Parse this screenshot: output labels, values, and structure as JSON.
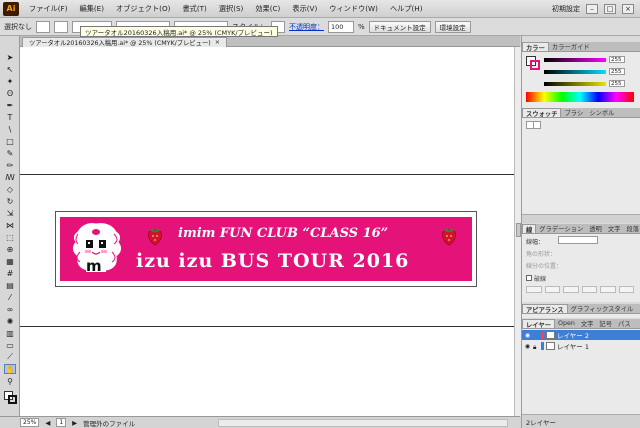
{
  "app": {
    "logo": "Ai"
  },
  "menu": [
    "ファイル(F)",
    "編集(E)",
    "オブジェクト(O)",
    "書式(T)",
    "選択(S)",
    "効果(C)",
    "表示(V)",
    "ウィンドウ(W)",
    "ヘルプ(H)"
  ],
  "workspace": {
    "label": "初期設定"
  },
  "control": {
    "selection": "選択なし",
    "style_label": "スタイル：",
    "opacity_label": "不透明度：",
    "opacity_value": "100",
    "opacity_unit": "%",
    "doc_setup": "ドキュメント設定",
    "prefs": "環境設定"
  },
  "tooltip": "ツアータオル20160326入稿用.ai* @ 25% (CMYK/プレビュー)",
  "document": {
    "tab_title": "ツアータオル20160326入稿用.ai* @ 25% (CMYK/プレビュー)",
    "close": "×"
  },
  "artwork": {
    "line1": "imim FUN CLUB “CLASS 16”",
    "line2": "izu izu BUS TOUR 2016",
    "mascot_letter": "m"
  },
  "status": {
    "zoom": "25%",
    "page": "1",
    "info": "管理外のファイル"
  },
  "panels": {
    "color": {
      "tabs": [
        "カラー",
        "カラーガイド"
      ],
      "values": [
        "255",
        "255",
        "255"
      ]
    },
    "swatches": {
      "tabs": [
        "スウォッチ",
        "ブラシ",
        "シンボル"
      ]
    },
    "stroke": {
      "tabs": [
        "線",
        "グラデーション",
        "透明",
        "文字",
        "段落"
      ],
      "weight_label": "線幅：",
      "corner_label": "角の形状：",
      "miter_label": "線分の位置：",
      "dash_label": "破線"
    },
    "appearance": {
      "tabs": [
        "アピアランス",
        "グラフィックスタイル"
      ]
    },
    "layers": {
      "tabs": [
        "レイヤー",
        "Open",
        "文字",
        "記号",
        "パス"
      ],
      "items": [
        "レイヤー 2",
        "レイヤー 1"
      ],
      "footer": "2レイヤー"
    }
  },
  "colors": {
    "banner": "#e5127a",
    "accent": "#3d7fd6"
  }
}
